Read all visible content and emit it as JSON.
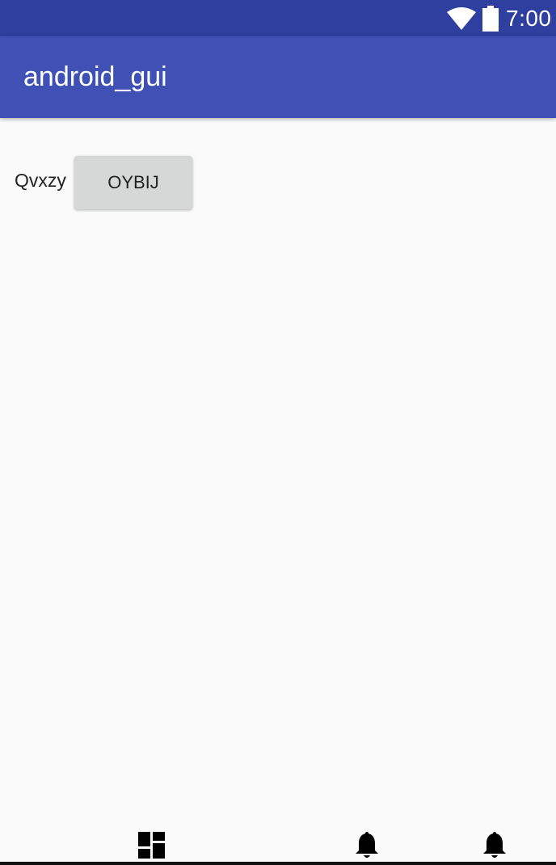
{
  "status_bar": {
    "time": "7:00",
    "icons": [
      "wifi-icon",
      "battery-icon"
    ],
    "background_color": "#2f3f9f"
  },
  "app_bar": {
    "title": "android_gui",
    "background_color": "#3f51b5"
  },
  "main": {
    "label": "Qvxzy",
    "button_label": "OYBIJ"
  },
  "bottom_nav": {
    "icons": [
      "dashboard-icon",
      "notification-bell-icon",
      "notification-bell-icon"
    ]
  }
}
